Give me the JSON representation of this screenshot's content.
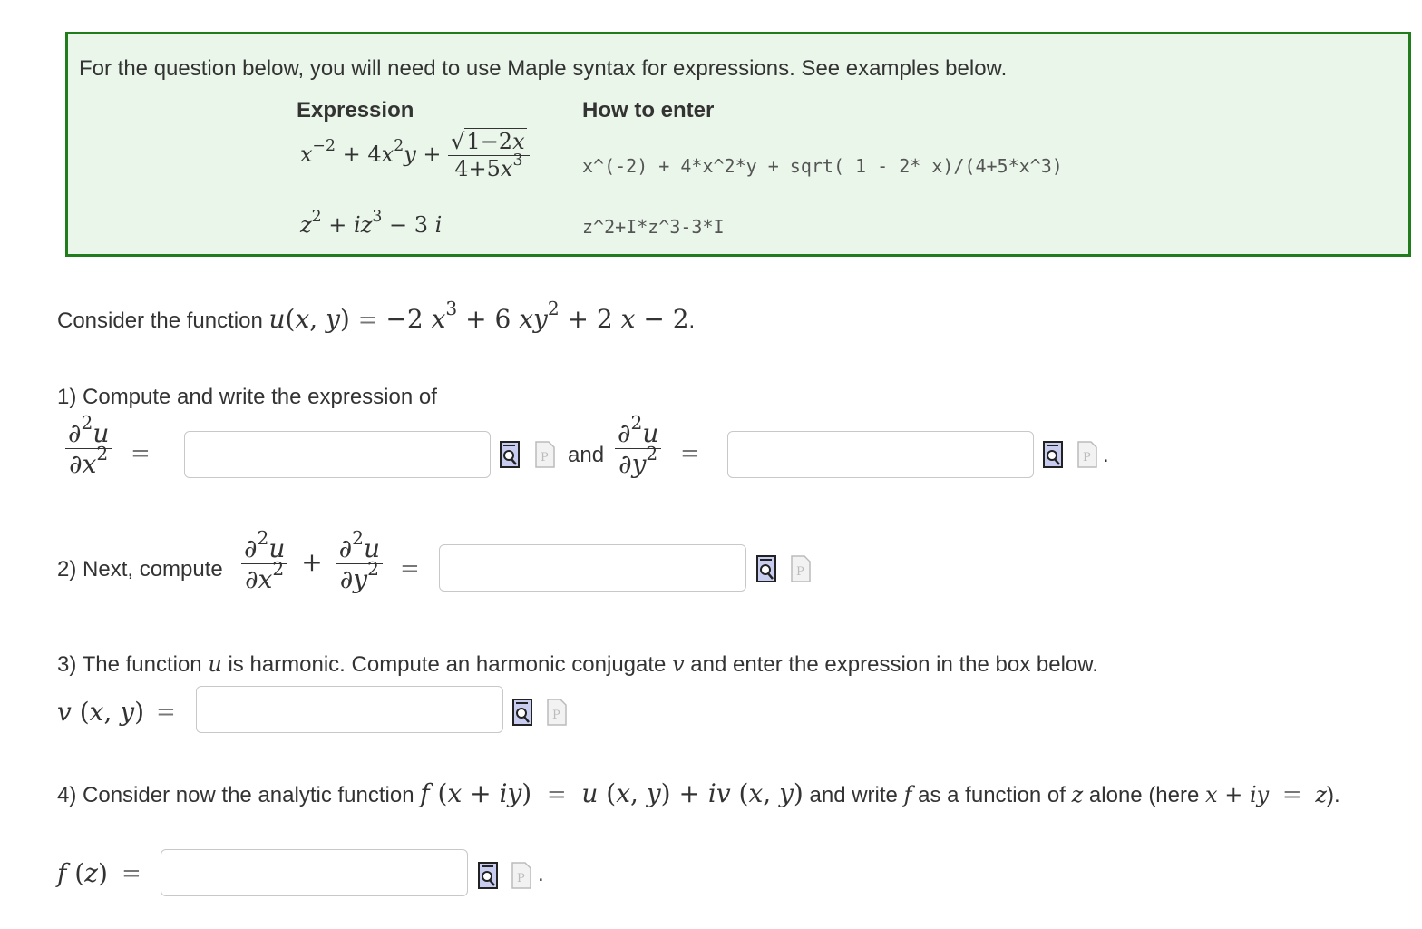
{
  "instructions": {
    "intro": "For the question below, you will need to use Maple syntax for expressions. See examples below.",
    "header_expression": "Expression",
    "header_how": "How to enter",
    "example1_syntax": "x^(-2) + 4*x^2*y + sqrt( 1 - 2* x)/(4+5*x^3)",
    "example2_syntax": "z^2+I*z^3-3*I"
  },
  "question": {
    "consider_prefix": "Consider the function",
    "part1_label": "1) Compute and write the expression of",
    "and_text": "and",
    "part2_label": "2) Next, compute",
    "part3_label_a": "3) The function",
    "part3_label_b": "is harmonic. Compute an harmonic conjugate",
    "part3_label_c": "and enter the expression in the box below.",
    "part4_label_a": "4) Consider now the analytic function",
    "part4_label_b": "and write",
    "part4_label_c": "as a function of",
    "part4_label_d": "alone (here",
    "part4_label_e": ")."
  },
  "answers": {
    "uxx": "",
    "uyy": "",
    "laplacian": "",
    "v": "",
    "f": ""
  }
}
